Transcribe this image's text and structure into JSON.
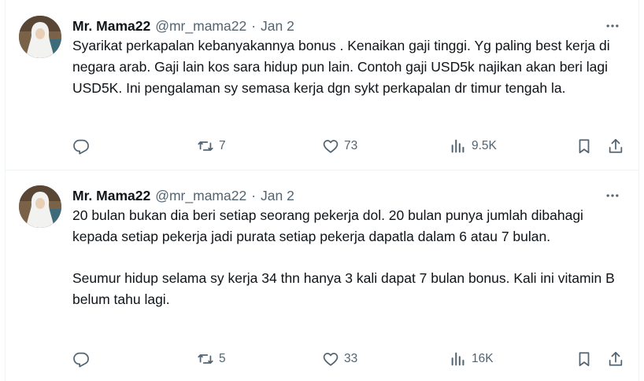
{
  "tweets": [
    {
      "author": {
        "name": "Mr. Mama22",
        "handle": "@mr_mama22"
      },
      "separator": "·",
      "date": "Jan 2",
      "text": "Syarikat perkapalan kebanyakannya bonus .  Kenaikan gaji tinggi. Yg paling best kerja di negara arab. Gaji lain kos sara hidup pun lain. Contoh gaji USD5k najikan akan beri lagi USD5K. Ini pengalaman sy semasa kerja dgn sykt perkapalan dr timur tengah la.",
      "stats": {
        "reposts": "7",
        "likes": "73",
        "views": "9.5K"
      }
    },
    {
      "author": {
        "name": "Mr. Mama22",
        "handle": "@mr_mama22"
      },
      "separator": "·",
      "date": "Jan 2",
      "text": "20 bulan bukan dia beri setiap seorang pekerja dol. 20 bulan punya jumlah dibahagi kepada setiap pekerja jadi purata setiap pekerja dapatla dalam 6 atau 7 bulan.\n\nSeumur hidup selama sy kerja 34 thn hanya 3 kali dapat 7 bulan bonus. Kali ini vitamin B belum tahu lagi.",
      "stats": {
        "reposts": "5",
        "likes": "33",
        "views": "16K"
      }
    }
  ],
  "icons": [
    "reply-icon",
    "repost-icon",
    "like-icon",
    "views-icon",
    "bookmark-icon",
    "share-icon",
    "more-icon"
  ],
  "colors": {
    "text": "#0f1419",
    "secondary": "#536471",
    "divider": "#eff3f4"
  }
}
